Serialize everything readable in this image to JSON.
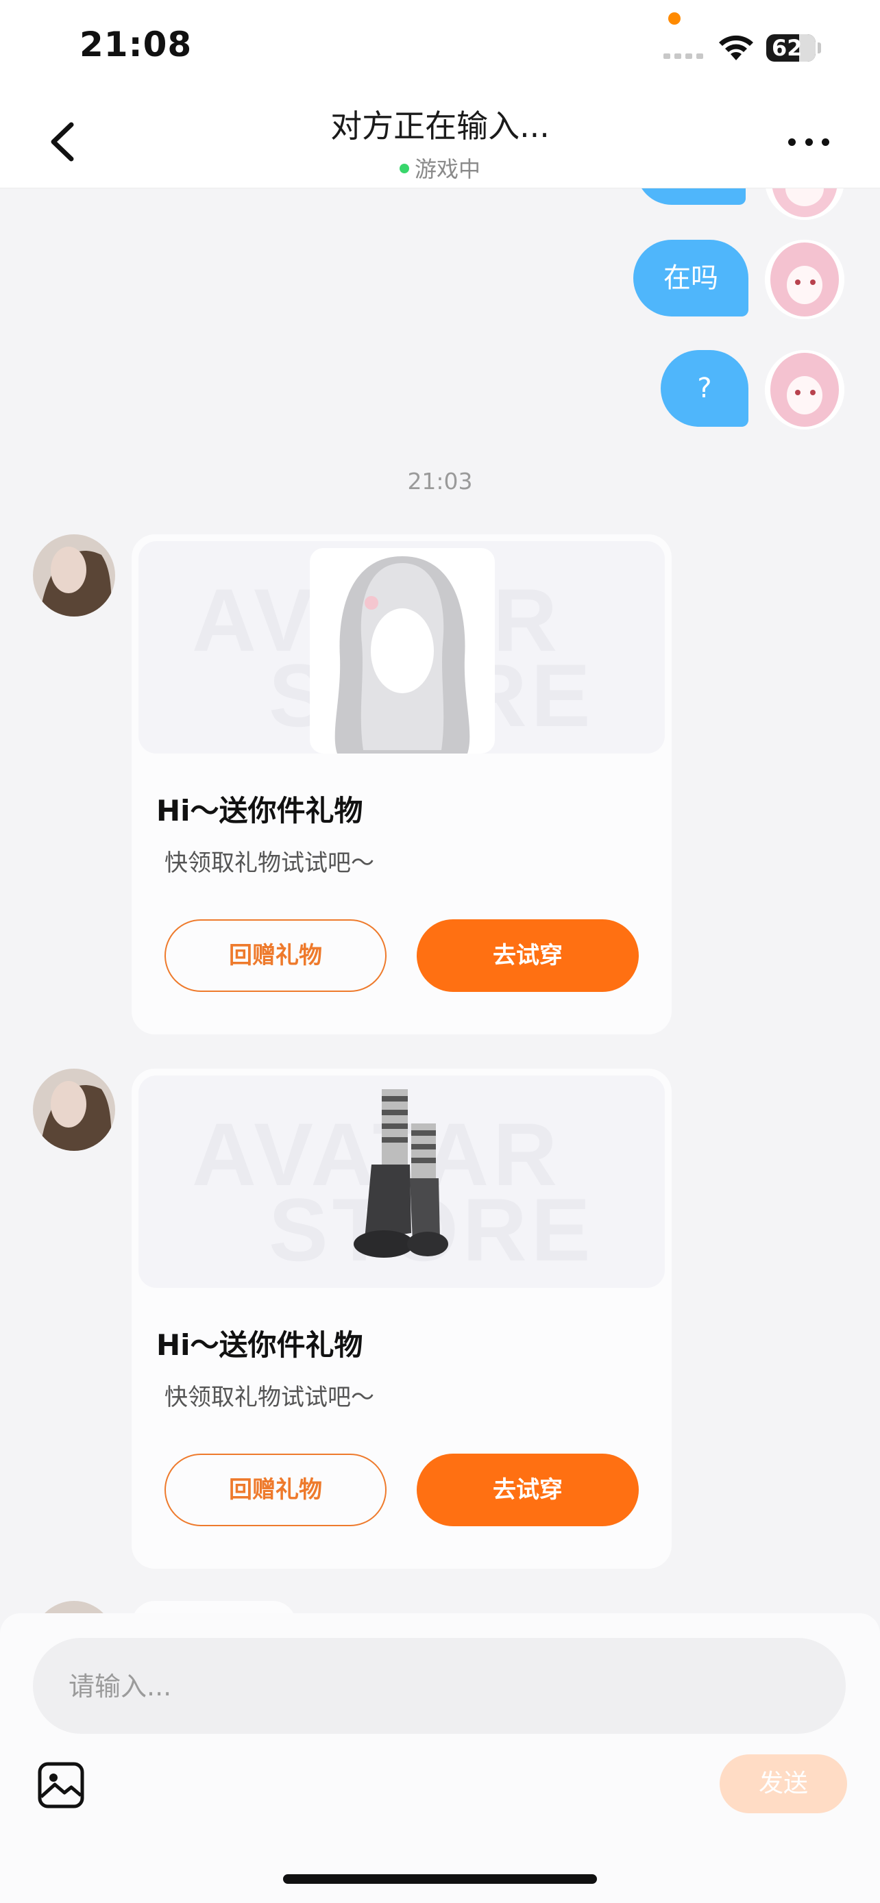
{
  "status_bar": {
    "time": "21:08",
    "battery": "62"
  },
  "header": {
    "title": "对方正在输入...",
    "status": "游戏中"
  },
  "messages": {
    "outgoing": [
      "在吗",
      "?"
    ],
    "time_separator": "21:03"
  },
  "gift_cards": [
    {
      "title": "Hi～送你件礼物",
      "subtitle": "快领取礼物试试吧～",
      "return_label": "回赠礼物",
      "try_label": "去试穿",
      "watermark_top": "AVATAR",
      "watermark_bottom": "STORE"
    },
    {
      "title": "Hi～送你件礼物",
      "subtitle": "快领取礼物试试吧～",
      "return_label": "回赠礼物",
      "try_label": "去试穿",
      "watermark_top": "AVATAR",
      "watermark_bottom": "STORE"
    }
  ],
  "composer": {
    "placeholder": "请输入...",
    "send_label": "发送"
  },
  "colors": {
    "outgoing_bubble": "#4fb6fb",
    "accent": "#ff7012",
    "online": "#38d66b"
  },
  "icons": {
    "back": "chevron-left-icon",
    "more": "more-dots-icon",
    "image": "image-icon",
    "wifi": "wifi-icon"
  }
}
